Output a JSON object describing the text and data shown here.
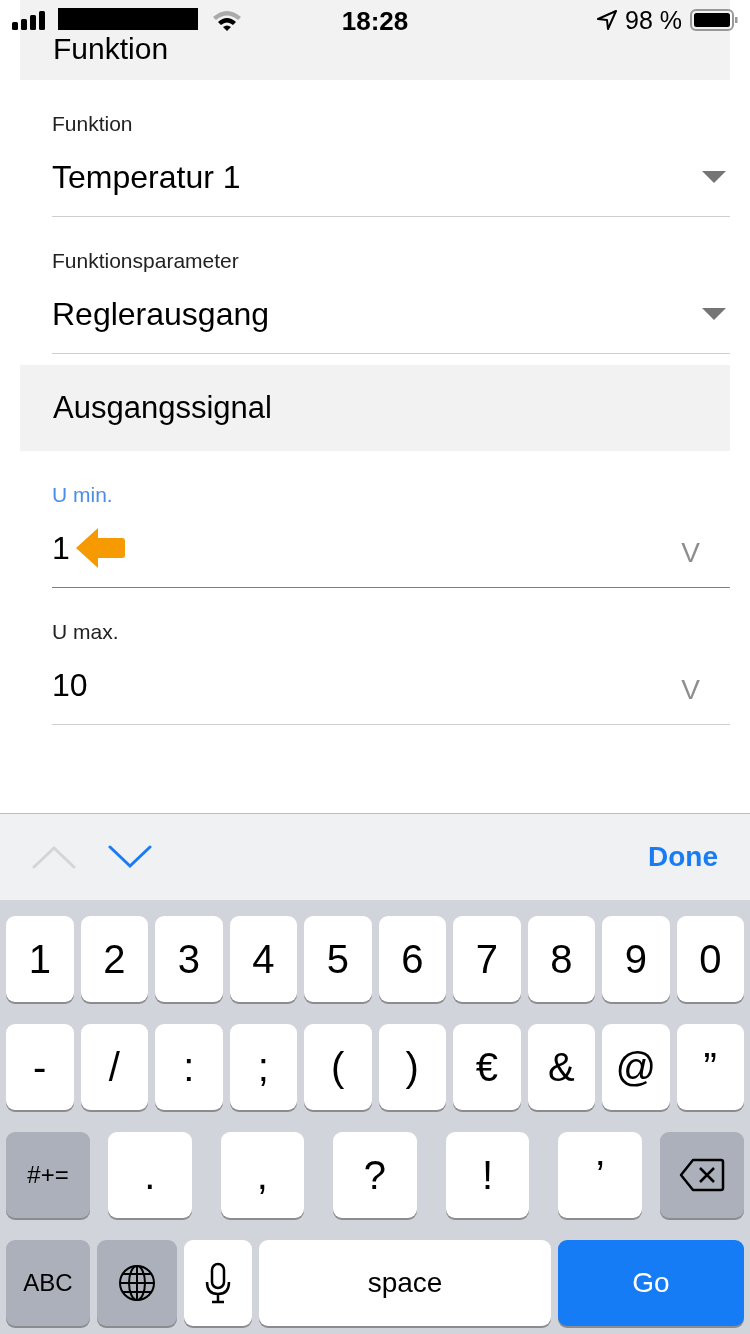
{
  "status_bar": {
    "time": "18:28",
    "battery": "98 %"
  },
  "header": {
    "title": "Funktion"
  },
  "form": [
    {
      "kind": "dropdown",
      "label": "Funktion",
      "value": "Temperatur 1",
      "focused": false
    },
    {
      "kind": "dropdown",
      "label": "Funktionsparameter",
      "value": "Reglerausgang",
      "focused": false
    },
    {
      "kind": "section",
      "title": "Ausgangssignal"
    },
    {
      "kind": "number",
      "label": "U min.",
      "value": "1",
      "unit": "V",
      "focused": true
    },
    {
      "kind": "number",
      "label": "U max.",
      "value": "10",
      "unit": "V",
      "focused": false
    }
  ],
  "accessory": {
    "previous_disabled": true,
    "next_disabled": false,
    "done": "Done"
  },
  "keyboard": [
    [
      {
        "kind": "char",
        "label": "1"
      },
      {
        "kind": "char",
        "label": "2"
      },
      {
        "kind": "char",
        "label": "3"
      },
      {
        "kind": "char",
        "label": "4"
      },
      {
        "kind": "char",
        "label": "5"
      },
      {
        "kind": "char",
        "label": "6"
      },
      {
        "kind": "char",
        "label": "7"
      },
      {
        "kind": "char",
        "label": "8"
      },
      {
        "kind": "char",
        "label": "9"
      },
      {
        "kind": "char",
        "label": "0"
      }
    ],
    [
      {
        "kind": "char",
        "label": "-"
      },
      {
        "kind": "char",
        "label": "/"
      },
      {
        "kind": "char",
        "label": ":"
      },
      {
        "kind": "char",
        "label": ";"
      },
      {
        "kind": "char",
        "label": "("
      },
      {
        "kind": "char",
        "label": ")"
      },
      {
        "kind": "char",
        "label": "€"
      },
      {
        "kind": "char",
        "label": "&"
      },
      {
        "kind": "char",
        "label": "@"
      },
      {
        "kind": "char",
        "label": "”"
      }
    ],
    [
      {
        "kind": "mod",
        "label": "#+="
      },
      {
        "kind": "char",
        "label": "."
      },
      {
        "kind": "char",
        "label": ","
      },
      {
        "kind": "char",
        "label": "?"
      },
      {
        "kind": "char",
        "label": "!"
      },
      {
        "kind": "char",
        "label": "’"
      },
      {
        "kind": "delete"
      }
    ],
    [
      {
        "kind": "mod",
        "label": "ABC"
      },
      {
        "kind": "globe"
      },
      {
        "kind": "mic"
      },
      {
        "kind": "space",
        "label": "space"
      },
      {
        "kind": "action",
        "label": "Go"
      }
    ]
  ]
}
